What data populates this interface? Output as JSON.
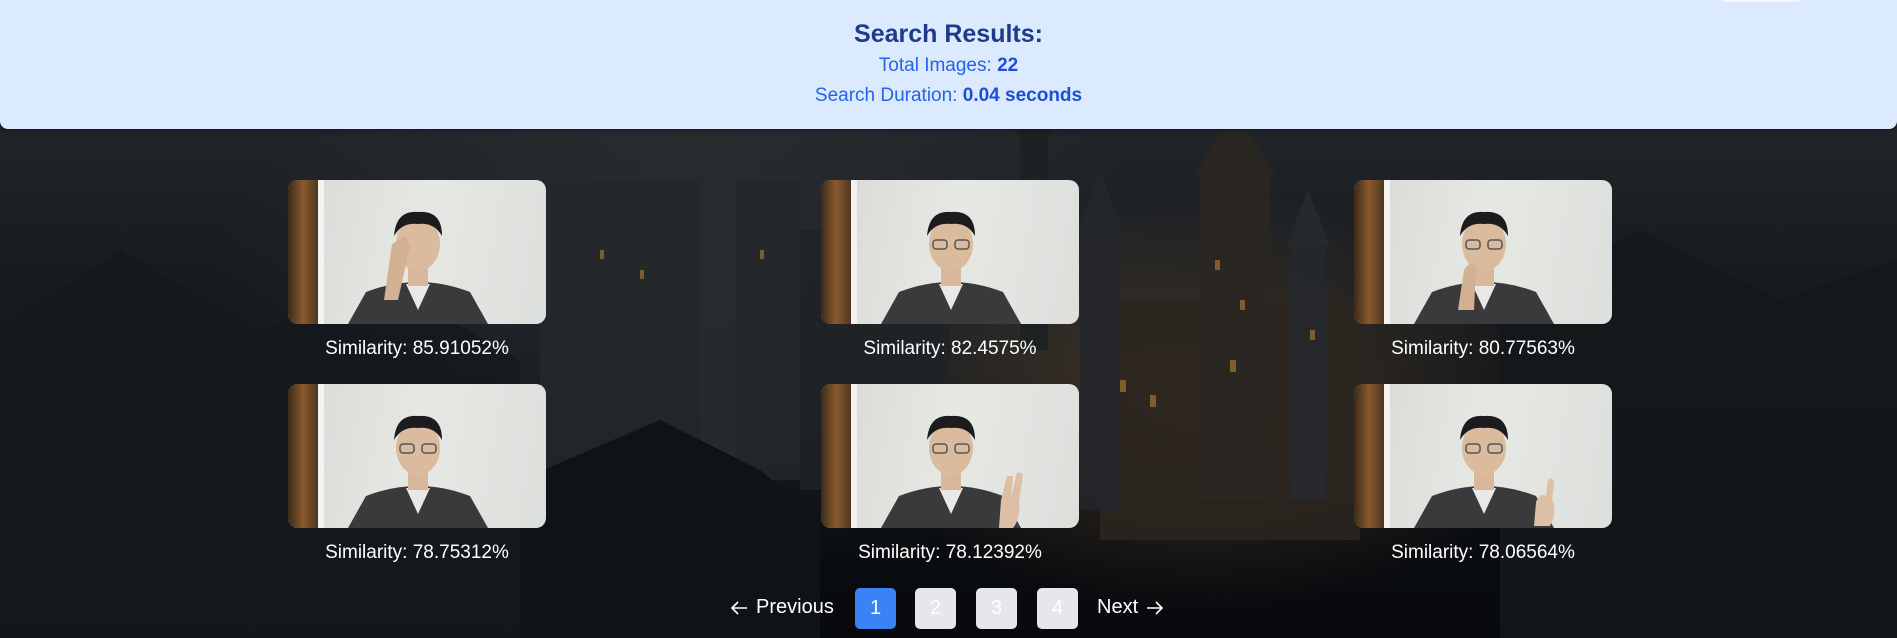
{
  "header": {
    "title": "Search Results:",
    "total_label": "Total Images:",
    "total_value": "22",
    "duration_label": "Search Duration:",
    "duration_value": "0.04 seconds"
  },
  "results": [
    {
      "caption": "Similarity: 85.91052%",
      "pose": "hand-on-forehead"
    },
    {
      "caption": "Similarity: 82.4575%",
      "pose": "neutral"
    },
    {
      "caption": "Similarity: 80.77563%",
      "pose": "hand-on-chin"
    },
    {
      "caption": "Similarity: 78.75312%",
      "pose": "neutral"
    },
    {
      "caption": "Similarity: 78.12392%",
      "pose": "peace-sign"
    },
    {
      "caption": "Similarity: 78.06564%",
      "pose": "thumbs-up"
    }
  ],
  "pagination": {
    "previous_label": "Previous",
    "next_label": "Next",
    "pages": [
      "1",
      "2",
      "3",
      "4"
    ],
    "current_page": "1"
  },
  "colors": {
    "header_bg": "#dbeafe",
    "title": "#1e3a8a",
    "accent": "#3b82f6"
  }
}
